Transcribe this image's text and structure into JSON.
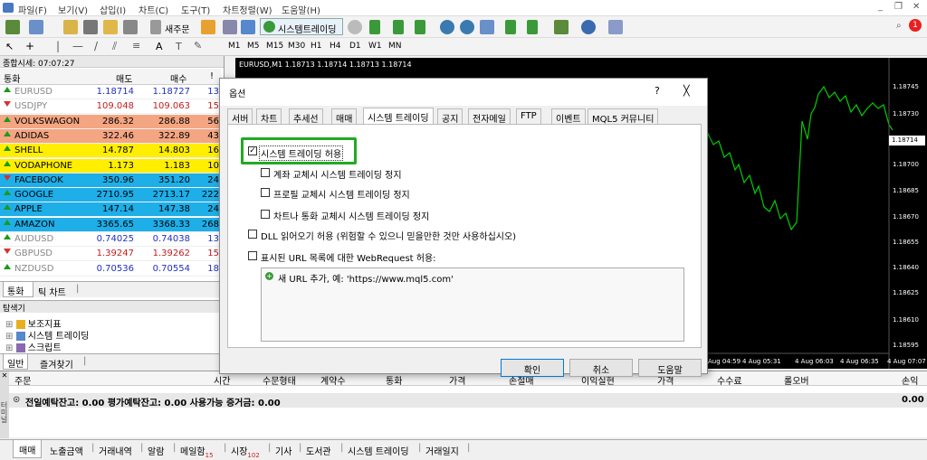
{
  "menubar": {
    "items": [
      "파일(F)",
      "보기(V)",
      "삽입(I)",
      "차트(C)",
      "도구(T)",
      "차트정렬(W)",
      "도움말(H)"
    ]
  },
  "toolbar": {
    "new_order": "새주문",
    "auto_trading": "시스템트레이딩"
  },
  "timeframes": [
    "M1",
    "M5",
    "M15",
    "M30",
    "H1",
    "H4",
    "D1",
    "W1",
    "MN"
  ],
  "notification_count": "1",
  "market_watch": {
    "title": "종합시세: 07:07:27",
    "headers": [
      "통화",
      "매도",
      "매수",
      "!"
    ],
    "rows": [
      {
        "symbol": "EURUSD",
        "bid": "1.18714",
        "ask": "1.18727",
        "spread": "13",
        "dir": "up",
        "bg": "#ffffff",
        "color": "#888888"
      },
      {
        "symbol": "USDJPY",
        "bid": "109.048",
        "ask": "109.063",
        "spread": "15",
        "dir": "dn",
        "bg": "#ffffff",
        "color": "#888888"
      },
      {
        "symbol": "VOLKSWAGON",
        "bid": "286.32",
        "ask": "286.88",
        "spread": "56",
        "dir": "up",
        "bg": "#f4a582",
        "color": "#000000"
      },
      {
        "symbol": "ADIDAS",
        "bid": "322.46",
        "ask": "322.89",
        "spread": "43",
        "dir": "up",
        "bg": "#f4a582",
        "color": "#000000"
      },
      {
        "symbol": "SHELL",
        "bid": "14.787",
        "ask": "14.803",
        "spread": "16",
        "dir": "up",
        "bg": "#ffee00",
        "color": "#000000"
      },
      {
        "symbol": "VODAPHONE",
        "bid": "1.173",
        "ask": "1.183",
        "spread": "10",
        "dir": "up",
        "bg": "#ffee00",
        "color": "#000000"
      },
      {
        "symbol": "FACEBOOK",
        "bid": "350.96",
        "ask": "351.20",
        "spread": "24",
        "dir": "dn",
        "bg": "#1eaee8",
        "color": "#000000"
      },
      {
        "symbol": "GOOGLE",
        "bid": "2710.95",
        "ask": "2713.17",
        "spread": "222",
        "dir": "up",
        "bg": "#1eaee8",
        "color": "#000000"
      },
      {
        "symbol": "APPLE",
        "bid": "147.14",
        "ask": "147.38",
        "spread": "24",
        "dir": "up",
        "bg": "#1eaee8",
        "color": "#000000"
      },
      {
        "symbol": "AMAZON",
        "bid": "3365.65",
        "ask": "3368.33",
        "spread": "268",
        "dir": "up",
        "bg": "#1eaee8",
        "color": "#000000"
      },
      {
        "symbol": "AUDUSD",
        "bid": "0.74025",
        "ask": "0.74038",
        "spread": "13",
        "dir": "up",
        "bg": "#ffffff",
        "color": "#888888"
      },
      {
        "symbol": "GBPUSD",
        "bid": "1.39247",
        "ask": "1.39262",
        "spread": "15",
        "dir": "dn",
        "bg": "#ffffff",
        "color": "#888888"
      },
      {
        "symbol": "NZDUSD",
        "bid": "0.70536",
        "ask": "0.70554",
        "spread": "18",
        "dir": "up",
        "bg": "#ffffff",
        "color": "#888888"
      }
    ],
    "tabs": [
      "통화",
      "틱 차트"
    ]
  },
  "navigator": {
    "title": "탐색기",
    "items": [
      "보조지표",
      "시스템 트레이딩",
      "스크립트"
    ],
    "tabs": [
      "일반",
      "즐겨찾기"
    ]
  },
  "chart": {
    "title": "EURUSD,M1  1.18713 1.18714 1.18713 1.18714",
    "current_price": "1.18714",
    "price_ticks": [
      "1.18745",
      "1.18730",
      "1.18714",
      "1.18700",
      "1.18685",
      "1.18670",
      "1.18655",
      "1.18640",
      "1.18625",
      "1.18610",
      "1.18595"
    ],
    "time_ticks": [
      "Aug 04:59",
      "4 Aug 05:31",
      "4 Aug 06:03",
      "4 Aug 06:35",
      "4 Aug 07:07"
    ]
  },
  "dialog": {
    "title": "옵션",
    "help": "?",
    "close": "╳",
    "tabs": [
      "서버",
      "차트",
      "추세선",
      "매매",
      "시스템 트레이딩",
      "공지",
      "전자메일",
      "FTP",
      "이벤트",
      "MQL5 커뮤니티"
    ],
    "allow_auto": "시스템 트레이딩 허용",
    "opt1": "계좌 교체시 시스템 트레이딩 정지",
    "opt2": "프로필 교체시 시스템 트레이딩 정지",
    "opt3": "차트나 통화 교체시 시스템 트레이딩 정지",
    "opt4": "DLL 읽어오기 허용 (위험할 수 있으니 믿을만한 것만 사용하십시오)",
    "opt5": "표시된 URL 목록에 대한 WebRequest 허용:",
    "url_placeholder": "새 URL 추가, 예: 'https://www.mql5.com'",
    "ok": "확인",
    "cancel": "취소",
    "help_btn": "도움말",
    "highlight_color": "#22aa22"
  },
  "terminal": {
    "headers": [
      "주문",
      "시간",
      "수문형태",
      "계약수",
      "통화",
      "가격",
      "손절매",
      "이익실현",
      "가격",
      "수수료",
      "롤오버",
      "손익"
    ],
    "balance": "전일예탁잔고: 0.00   평가예탁잔고: 0.00   사용가능 증거금: 0.00",
    "profit": "0.00",
    "side_label": "터미널",
    "tabs": [
      "매매",
      "노출금액",
      "거래내역",
      "알람",
      "메일함",
      "시장",
      "기사",
      "도서관",
      "시스템 트레이딩",
      "거래일지"
    ],
    "mail_badge": "15",
    "market_badge": "102"
  }
}
